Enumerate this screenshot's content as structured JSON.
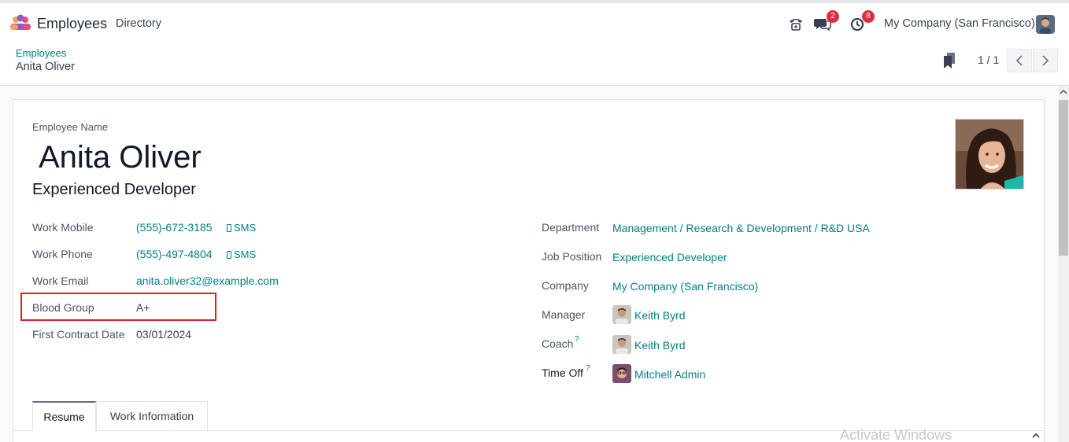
{
  "navbar": {
    "app_name": "Employees",
    "menu_directory": "Directory",
    "chat_badge": "2",
    "activity_badge": "8",
    "company": "My Company (San Francisco)"
  },
  "breadcrumb": {
    "parent": "Employees",
    "current": "Anita Oliver"
  },
  "pager": {
    "value": "1 / 1"
  },
  "employee": {
    "name_label": "Employee Name",
    "name": "Anita Oliver",
    "job_title": "Experienced Developer"
  },
  "left_fields": {
    "work_mobile_label": "Work Mobile",
    "work_mobile": "(555)-672-3185",
    "work_phone_label": "Work Phone",
    "work_phone": "(555)-497-4804",
    "sms_label": "SMS",
    "work_email_label": "Work Email",
    "work_email": "anita.oliver32@example.com",
    "blood_group_label": "Blood Group",
    "blood_group": "A+",
    "first_contract_label": "First Contract Date",
    "first_contract": "03/01/2024"
  },
  "right_fields": {
    "department_label": "Department",
    "department": "Management / Research & Development / R&D USA",
    "job_position_label": "Job Position",
    "job_position": "Experienced Developer",
    "company_label": "Company",
    "company": "My Company (San Francisco)",
    "manager_label": "Manager",
    "manager": "Keith Byrd",
    "coach_label": "Coach",
    "coach": "Keith Byrd",
    "time_off_label": "Time Off",
    "time_off": "Mitchell Admin",
    "help_mark": "?"
  },
  "tabs": [
    {
      "label": "Resume",
      "active": true
    },
    {
      "label": "Work Information",
      "active": false
    }
  ],
  "watermark": "Activate Windows",
  "colors": {
    "link": "#017e84",
    "badge": "#e02d3c",
    "highlight": "#e11d2a",
    "tab_accent": "#71639e"
  }
}
